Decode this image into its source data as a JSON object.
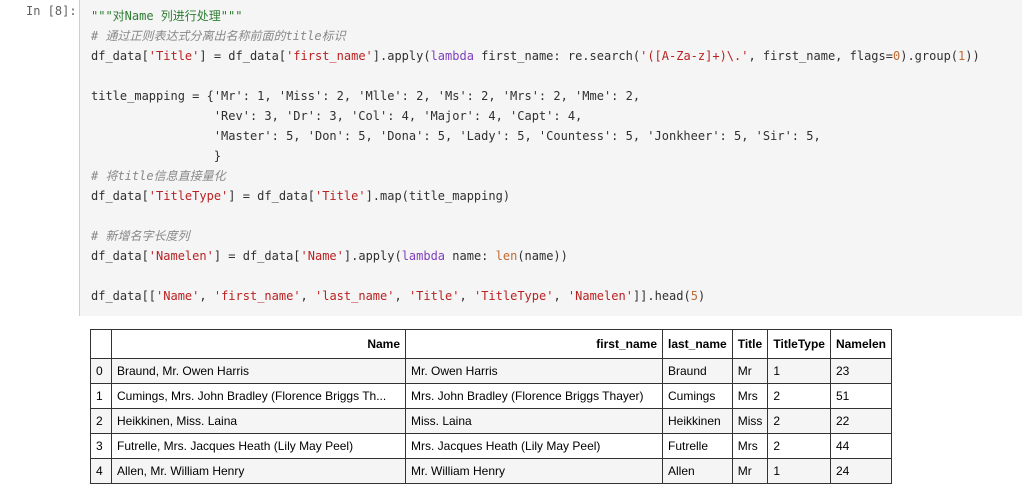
{
  "cell": {
    "prompt": "In [8]:",
    "lines": {
      "l1_docstring": "\"\"\"对Name 列进行处理\"\"\"",
      "l2_comment": "# 通过正则表达式分离出名称前面的title标识",
      "l3_a": "df_data[",
      "l3_s1": "'Title'",
      "l3_b": "] = df_data[",
      "l3_s2": "'first_name'",
      "l3_c": "].apply(",
      "l3_k": "lambda",
      "l3_d": " first_name: re.search(",
      "l3_s3": "'([A-Za-z]+)\\.'",
      "l3_e": ", first_name, flags=",
      "l3_n1": "0",
      "l3_f": ").group(",
      "l3_n2": "1",
      "l3_g": "))",
      "l5": "title_mapping = {'Mr': 1, 'Miss': 2, 'Mlle': 2, 'Ms': 2, 'Mrs': 2, 'Mme': 2,",
      "l6": "                 'Rev': 3, 'Dr': 3, 'Col': 4, 'Major': 4, 'Capt': 4,",
      "l7": "                 'Master': 5, 'Don': 5, 'Dona': 5, 'Lady': 5, 'Countess': 5, 'Jonkheer': 5, 'Sir': 5,",
      "l8": "                 }",
      "l9_comment": "# 将title信息直接量化",
      "l10_a": "df_data[",
      "l10_s1": "'TitleType'",
      "l10_b": "] = df_data[",
      "l10_s2": "'Title'",
      "l10_c": "].map(title_mapping)",
      "l12_comment": "# 新增名字长度列",
      "l13_a": "df_data[",
      "l13_s1": "'Namelen'",
      "l13_b": "] = df_data[",
      "l13_s2": "'Name'",
      "l13_c": "].apply(",
      "l13_k": "lambda",
      "l13_d": " name: ",
      "l13_f": "len",
      "l13_e": "(name))",
      "l15_a": "df_data[[",
      "l15_s1": "'Name'",
      "l15_s2": "'first_name'",
      "l15_s3": "'last_name'",
      "l15_s4": "'Title'",
      "l15_s5": "'TitleType'",
      "l15_s6": "'Namelen'",
      "l15_sep": ", ",
      "l15_b": "]].head(",
      "l15_n": "5",
      "l15_c": ")"
    }
  },
  "output": {
    "headers": [
      "",
      "Name",
      "first_name",
      "last_name",
      "Title",
      "TitleType",
      "Namelen"
    ],
    "rows": [
      [
        "0",
        "Braund, Mr. Owen Harris",
        "Mr. Owen Harris",
        "Braund",
        "Mr",
        "1",
        "23"
      ],
      [
        "1",
        "Cumings, Mrs. John Bradley (Florence Briggs Th...",
        "Mrs. John Bradley (Florence Briggs Thayer)",
        "Cumings",
        "Mrs",
        "2",
        "51"
      ],
      [
        "2",
        "Heikkinen, Miss. Laina",
        "Miss. Laina",
        "Heikkinen",
        "Miss",
        "2",
        "22"
      ],
      [
        "3",
        "Futrelle, Mrs. Jacques Heath (Lily May Peel)",
        "Mrs. Jacques Heath (Lily May Peel)",
        "Futrelle",
        "Mrs",
        "2",
        "44"
      ],
      [
        "4",
        "Allen, Mr. William Henry",
        "Mr. William Henry",
        "Allen",
        "Mr",
        "1",
        "24"
      ]
    ]
  }
}
